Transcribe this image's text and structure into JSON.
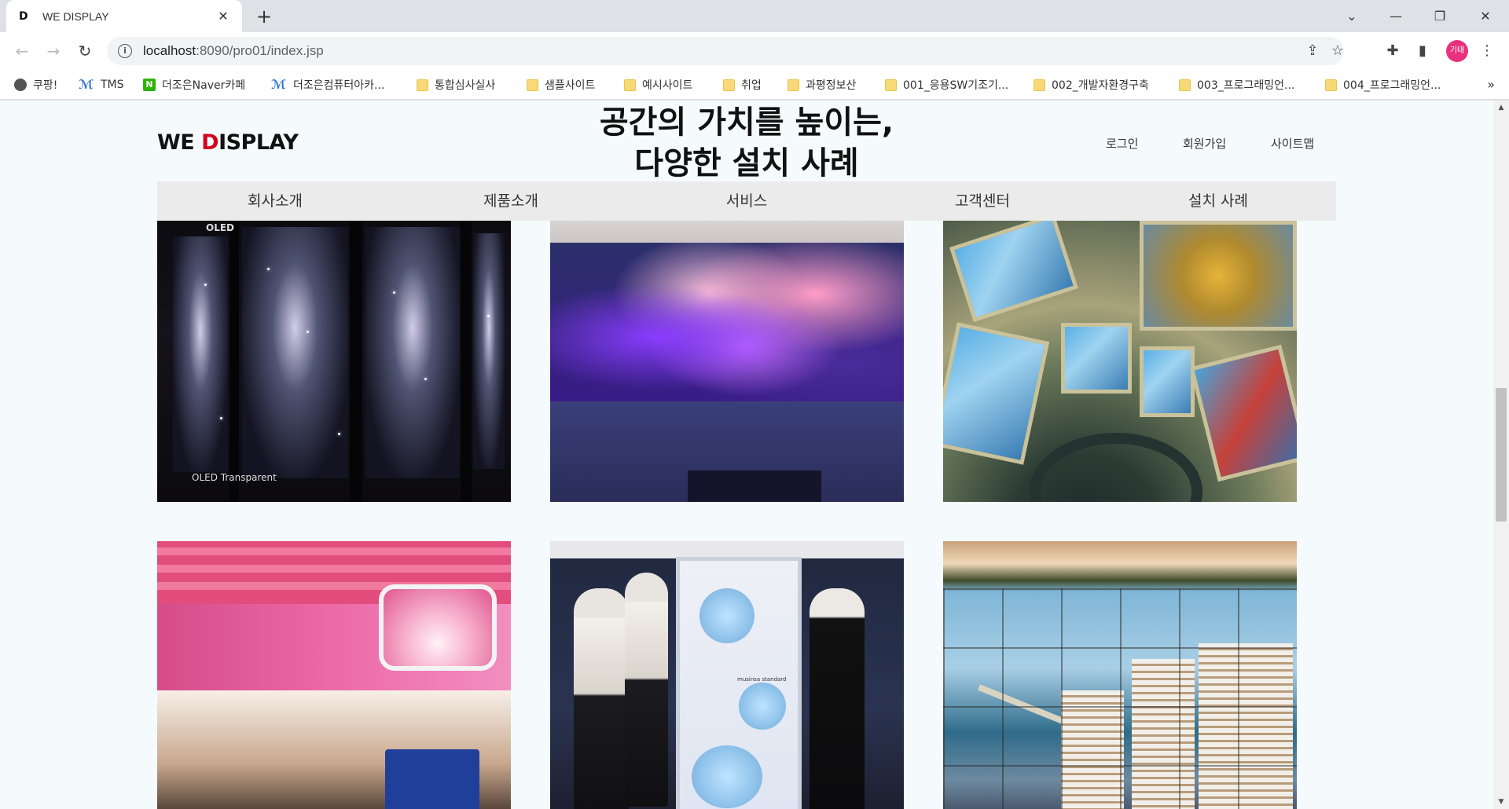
{
  "browser": {
    "tab_title": "WE DISPLAY",
    "tab_favicon": "D",
    "url_host": "localhost",
    "url_rest": ":8090/pro01/index.jsp",
    "profile_label": "기태",
    "bookmarks": [
      {
        "label": "쿠팡!",
        "icon": "globe-icon"
      },
      {
        "label": "TMS",
        "icon": "tz-icon"
      },
      {
        "label": "더조은Naver카페",
        "icon": "naver-icon"
      },
      {
        "label": "더조은컴퓨터아카...",
        "icon": "tz-icon"
      },
      {
        "label": "통합심사실사",
        "icon": "folder-icon"
      },
      {
        "label": "샘플사이트",
        "icon": "folder-icon"
      },
      {
        "label": "예시사이트",
        "icon": "folder-icon"
      },
      {
        "label": "취업",
        "icon": "folder-icon"
      },
      {
        "label": "과평정보산",
        "icon": "folder-icon"
      },
      {
        "label": "001_응용SW기조기...",
        "icon": "folder-icon"
      },
      {
        "label": "002_개발자환경구축",
        "icon": "folder-icon"
      },
      {
        "label": "003_프로그래밍언...",
        "icon": "folder-icon"
      },
      {
        "label": "004_프로그래밍언...",
        "icon": "folder-icon"
      }
    ],
    "bookmarks_more": "»"
  },
  "page": {
    "logo_pre": "WE ",
    "logo_d": "D",
    "logo_post": "ISPLAY",
    "hero_line1": "공간의 가치를 높이는,",
    "hero_line2": "다양한 설치 사례",
    "util_links": [
      "로그인",
      "회원가입",
      "사이트맵"
    ],
    "nav": [
      "회사소개",
      "제품소개",
      "서비스",
      "고객센터",
      "설치 사례"
    ],
    "card_tags": {
      "oled": "OLED",
      "transparent": "OLED Transparent",
      "store": "musinsa standard"
    }
  },
  "colors": {
    "page_bg": "#f5fbfd",
    "nav_bg": "#ebebeb",
    "logo_accent": "#d6001c",
    "profile": "#e8317e"
  }
}
